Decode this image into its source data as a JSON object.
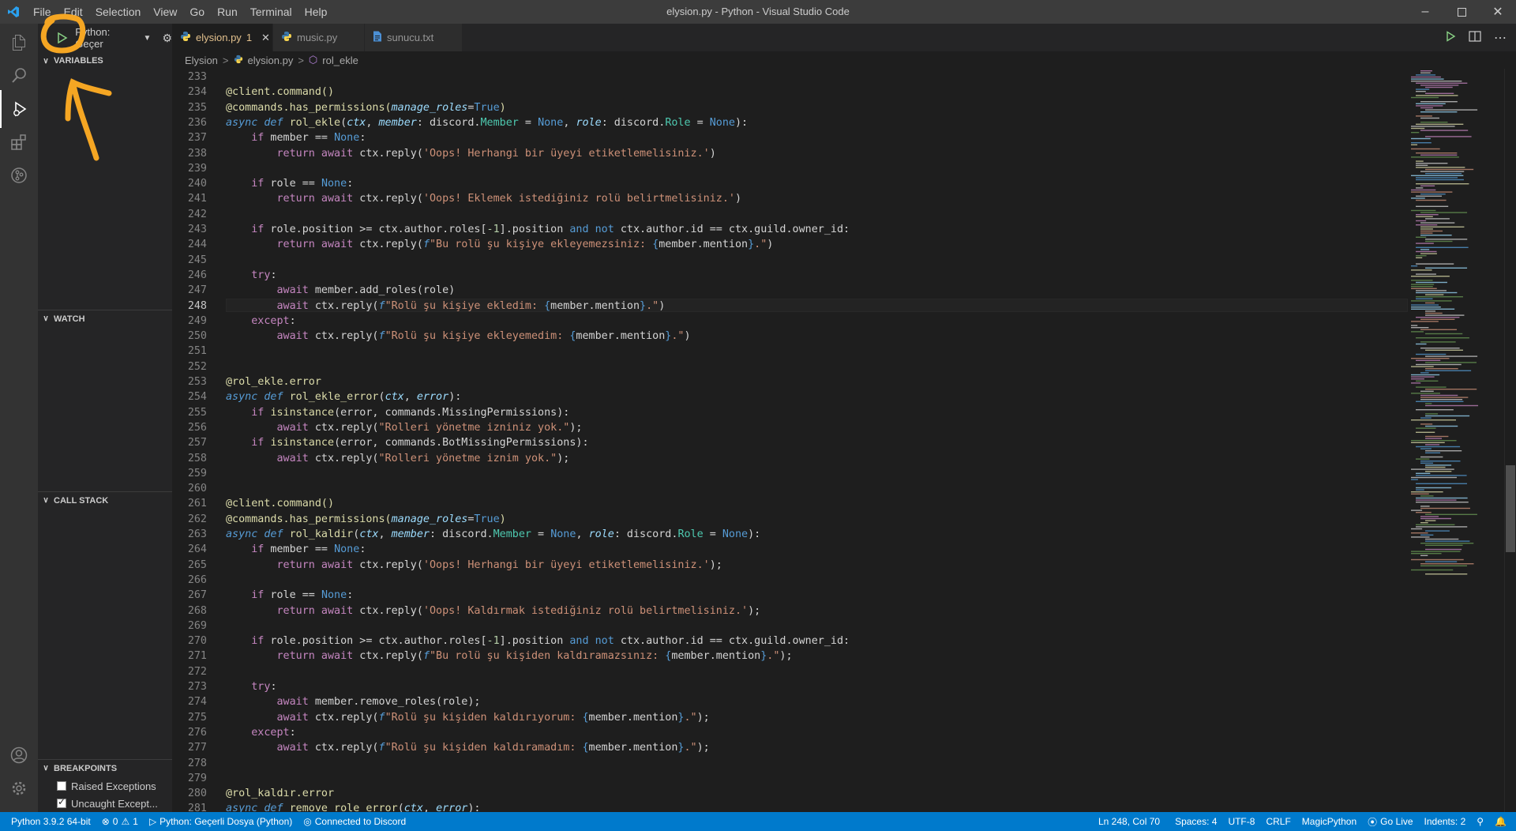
{
  "window": {
    "title": "elysion.py - Python - Visual Studio Code"
  },
  "menu": [
    "File",
    "Edit",
    "Selection",
    "View",
    "Go",
    "Run",
    "Terminal",
    "Help"
  ],
  "debug": {
    "config": "Python: Geçer"
  },
  "sidebar": {
    "sections": {
      "variables": "VARIABLES",
      "watch": "WATCH",
      "call_stack": "CALL STACK",
      "breakpoints": "BREAKPOINTS"
    },
    "breakpoints": [
      {
        "label": "Raised Exceptions",
        "checked": false
      },
      {
        "label": "Uncaught Except...",
        "checked": true
      }
    ]
  },
  "tabs": [
    {
      "label": "elysion.py",
      "modified": "1",
      "active": true,
      "icon": "python-icon"
    },
    {
      "label": "music.py",
      "active": false,
      "icon": "python-icon"
    },
    {
      "label": "sunucu.txt",
      "active": false,
      "icon": "text-file-icon"
    }
  ],
  "breadcrumbs": {
    "folder": "Elysion",
    "file": "elysion.py",
    "symbol": "rol_ekle"
  },
  "editor": {
    "current_line": 248,
    "lines": [
      {
        "n": "233",
        "t": []
      },
      {
        "n": "234",
        "t": [
          [
            "dec",
            "@client.command()"
          ]
        ]
      },
      {
        "n": "235",
        "t": [
          [
            "dec",
            "@commands.has_permissions("
          ],
          [
            "pm",
            "manage_roles"
          ],
          [
            "pl",
            "="
          ],
          [
            "cst",
            "True"
          ],
          [
            "dec",
            ")"
          ]
        ]
      },
      {
        "n": "236",
        "t": [
          [
            "sk",
            "async def "
          ],
          [
            "fn",
            "rol_ekle"
          ],
          [
            "pl",
            "("
          ],
          [
            "pm",
            "ctx"
          ],
          [
            "pl",
            ", "
          ],
          [
            "pm",
            "member"
          ],
          [
            "pl",
            ": discord."
          ],
          [
            "cls",
            "Member"
          ],
          [
            "pl",
            " = "
          ],
          [
            "cst",
            "None"
          ],
          [
            "pl",
            ", "
          ],
          [
            "pm",
            "role"
          ],
          [
            "pl",
            ": discord."
          ],
          [
            "cls",
            "Role"
          ],
          [
            "pl",
            " = "
          ],
          [
            "cst",
            "None"
          ],
          [
            "pl",
            "):"
          ]
        ]
      },
      {
        "n": "237",
        "t": [
          [
            "pl",
            "    "
          ],
          [
            "kw",
            "if"
          ],
          [
            "pl",
            " member == "
          ],
          [
            "cst",
            "None"
          ],
          [
            "pl",
            ":"
          ]
        ]
      },
      {
        "n": "238",
        "t": [
          [
            "pl",
            "        "
          ],
          [
            "kw",
            "return await"
          ],
          [
            "pl",
            " ctx.reply("
          ],
          [
            "str",
            "'Oops! Herhangi bir üyeyi etiketlemelisiniz.'"
          ],
          [
            "pl",
            ")"
          ]
        ]
      },
      {
        "n": "239",
        "t": []
      },
      {
        "n": "240",
        "t": [
          [
            "pl",
            "    "
          ],
          [
            "kw",
            "if"
          ],
          [
            "pl",
            " role == "
          ],
          [
            "cst",
            "None"
          ],
          [
            "pl",
            ":"
          ]
        ]
      },
      {
        "n": "241",
        "t": [
          [
            "pl",
            "        "
          ],
          [
            "kw",
            "return await"
          ],
          [
            "pl",
            " ctx.reply("
          ],
          [
            "str",
            "'Oops! Eklemek istediğiniz rolü belirtmelisiniz.'"
          ],
          [
            "pl",
            ")"
          ]
        ]
      },
      {
        "n": "242",
        "t": []
      },
      {
        "n": "243",
        "t": [
          [
            "pl",
            "    "
          ],
          [
            "kw",
            "if"
          ],
          [
            "pl",
            " role.position >= ctx.author.roles["
          ],
          [
            "num",
            "-1"
          ],
          [
            "pl",
            "].position "
          ],
          [
            "cst",
            "and not"
          ],
          [
            "pl",
            " ctx.author.id == ctx.guild.owner_id:"
          ]
        ]
      },
      {
        "n": "244",
        "t": [
          [
            "pl",
            "        "
          ],
          [
            "kw",
            "return await"
          ],
          [
            "pl",
            " ctx.reply("
          ],
          [
            "fpre",
            "f"
          ],
          [
            "str",
            "\"Bu rolü şu kişiye ekleyemezsiniz: "
          ],
          [
            "br",
            "{"
          ],
          [
            "pl",
            "member.mention"
          ],
          [
            "br",
            "}"
          ],
          [
            "str",
            ".\""
          ],
          [
            "pl",
            ")"
          ]
        ]
      },
      {
        "n": "245",
        "t": []
      },
      {
        "n": "246",
        "t": [
          [
            "pl",
            "    "
          ],
          [
            "kw",
            "try"
          ],
          [
            "pl",
            ":"
          ]
        ]
      },
      {
        "n": "247",
        "t": [
          [
            "pl",
            "        "
          ],
          [
            "kw",
            "await"
          ],
          [
            "pl",
            " member.add_roles(role)"
          ]
        ]
      },
      {
        "n": "248",
        "t": [
          [
            "pl",
            "        "
          ],
          [
            "kw",
            "await"
          ],
          [
            "pl",
            " ctx.reply("
          ],
          [
            "fpre",
            "f"
          ],
          [
            "str",
            "\"Rolü şu kişiye ekledim: "
          ],
          [
            "br",
            "{"
          ],
          [
            "pl",
            "member.mention"
          ],
          [
            "br",
            "}"
          ],
          [
            "str",
            ".\""
          ],
          [
            "pl",
            ")"
          ]
        ]
      },
      {
        "n": "249",
        "t": [
          [
            "pl",
            "    "
          ],
          [
            "kw",
            "except"
          ],
          [
            "pl",
            ":"
          ]
        ]
      },
      {
        "n": "250",
        "t": [
          [
            "pl",
            "        "
          ],
          [
            "kw",
            "await"
          ],
          [
            "pl",
            " ctx.reply("
          ],
          [
            "fpre",
            "f"
          ],
          [
            "str",
            "\"Rolü şu kişiye ekleyemedim: "
          ],
          [
            "br",
            "{"
          ],
          [
            "pl",
            "member.mention"
          ],
          [
            "br",
            "}"
          ],
          [
            "str",
            ".\""
          ],
          [
            "pl",
            ")"
          ]
        ]
      },
      {
        "n": "251",
        "t": []
      },
      {
        "n": "252",
        "t": []
      },
      {
        "n": "253",
        "t": [
          [
            "dec",
            "@rol_ekle.error"
          ]
        ]
      },
      {
        "n": "254",
        "t": [
          [
            "sk",
            "async def "
          ],
          [
            "fn",
            "rol_ekle_error"
          ],
          [
            "pl",
            "("
          ],
          [
            "pm",
            "ctx"
          ],
          [
            "pl",
            ", "
          ],
          [
            "pm",
            "error"
          ],
          [
            "pl",
            "):"
          ]
        ]
      },
      {
        "n": "255",
        "t": [
          [
            "pl",
            "    "
          ],
          [
            "kw",
            "if"
          ],
          [
            "pl",
            " "
          ],
          [
            "fn",
            "isinstance"
          ],
          [
            "pl",
            "(error, commands.MissingPermissions):"
          ]
        ]
      },
      {
        "n": "256",
        "t": [
          [
            "pl",
            "        "
          ],
          [
            "kw",
            "await"
          ],
          [
            "pl",
            " ctx.reply("
          ],
          [
            "str",
            "\"Rolleri yönetme izniniz yok.\""
          ],
          [
            "pl",
            ");"
          ]
        ]
      },
      {
        "n": "257",
        "t": [
          [
            "pl",
            "    "
          ],
          [
            "kw",
            "if"
          ],
          [
            "pl",
            " "
          ],
          [
            "fn",
            "isinstance"
          ],
          [
            "pl",
            "(error, commands.BotMissingPermissions):"
          ]
        ]
      },
      {
        "n": "258",
        "t": [
          [
            "pl",
            "        "
          ],
          [
            "kw",
            "await"
          ],
          [
            "pl",
            " ctx.reply("
          ],
          [
            "str",
            "\"Rolleri yönetme iznim yok.\""
          ],
          [
            "pl",
            ");"
          ]
        ]
      },
      {
        "n": "259",
        "t": []
      },
      {
        "n": "260",
        "t": []
      },
      {
        "n": "261",
        "t": [
          [
            "dec",
            "@client.command()"
          ]
        ]
      },
      {
        "n": "262",
        "t": [
          [
            "dec",
            "@commands.has_permissions("
          ],
          [
            "pm",
            "manage_roles"
          ],
          [
            "pl",
            "="
          ],
          [
            "cst",
            "True"
          ],
          [
            "dec",
            ")"
          ]
        ]
      },
      {
        "n": "263",
        "t": [
          [
            "sk",
            "async def "
          ],
          [
            "fn",
            "rol_kaldir"
          ],
          [
            "pl",
            "("
          ],
          [
            "pm",
            "ctx"
          ],
          [
            "pl",
            ", "
          ],
          [
            "pm",
            "member"
          ],
          [
            "pl",
            ": discord."
          ],
          [
            "cls",
            "Member"
          ],
          [
            "pl",
            " = "
          ],
          [
            "cst",
            "None"
          ],
          [
            "pl",
            ", "
          ],
          [
            "pm",
            "role"
          ],
          [
            "pl",
            ": discord."
          ],
          [
            "cls",
            "Role"
          ],
          [
            "pl",
            " = "
          ],
          [
            "cst",
            "None"
          ],
          [
            "pl",
            "):"
          ]
        ]
      },
      {
        "n": "264",
        "t": [
          [
            "pl",
            "    "
          ],
          [
            "kw",
            "if"
          ],
          [
            "pl",
            " member == "
          ],
          [
            "cst",
            "None"
          ],
          [
            "pl",
            ":"
          ]
        ]
      },
      {
        "n": "265",
        "t": [
          [
            "pl",
            "        "
          ],
          [
            "kw",
            "return await"
          ],
          [
            "pl",
            " ctx.reply("
          ],
          [
            "str",
            "'Oops! Herhangi bir üyeyi etiketlemelisiniz.'"
          ],
          [
            "pl",
            ");"
          ]
        ]
      },
      {
        "n": "266",
        "t": []
      },
      {
        "n": "267",
        "t": [
          [
            "pl",
            "    "
          ],
          [
            "kw",
            "if"
          ],
          [
            "pl",
            " role == "
          ],
          [
            "cst",
            "None"
          ],
          [
            "pl",
            ":"
          ]
        ]
      },
      {
        "n": "268",
        "t": [
          [
            "pl",
            "        "
          ],
          [
            "kw",
            "return await"
          ],
          [
            "pl",
            " ctx.reply("
          ],
          [
            "str",
            "'Oops! Kaldırmak istediğiniz rolü belirtmelisiniz.'"
          ],
          [
            "pl",
            ");"
          ]
        ]
      },
      {
        "n": "269",
        "t": []
      },
      {
        "n": "270",
        "t": [
          [
            "pl",
            "    "
          ],
          [
            "kw",
            "if"
          ],
          [
            "pl",
            " role.position >= ctx.author.roles["
          ],
          [
            "num",
            "-1"
          ],
          [
            "pl",
            "].position "
          ],
          [
            "cst",
            "and not"
          ],
          [
            "pl",
            " ctx.author.id == ctx.guild.owner_id:"
          ]
        ]
      },
      {
        "n": "271",
        "t": [
          [
            "pl",
            "        "
          ],
          [
            "kw",
            "return await"
          ],
          [
            "pl",
            " ctx.reply("
          ],
          [
            "fpre",
            "f"
          ],
          [
            "str",
            "\"Bu rolü şu kişiden kaldıramazsınız: "
          ],
          [
            "br",
            "{"
          ],
          [
            "pl",
            "member.mention"
          ],
          [
            "br",
            "}"
          ],
          [
            "str",
            ".\""
          ],
          [
            "pl",
            ");"
          ]
        ]
      },
      {
        "n": "272",
        "t": []
      },
      {
        "n": "273",
        "t": [
          [
            "pl",
            "    "
          ],
          [
            "kw",
            "try"
          ],
          [
            "pl",
            ":"
          ]
        ]
      },
      {
        "n": "274",
        "t": [
          [
            "pl",
            "        "
          ],
          [
            "kw",
            "await"
          ],
          [
            "pl",
            " member.remove_roles(role);"
          ]
        ]
      },
      {
        "n": "275",
        "t": [
          [
            "pl",
            "        "
          ],
          [
            "kw",
            "await"
          ],
          [
            "pl",
            " ctx.reply("
          ],
          [
            "fpre",
            "f"
          ],
          [
            "str",
            "\"Rolü şu kişiden kaldırıyorum: "
          ],
          [
            "br",
            "{"
          ],
          [
            "pl",
            "member.mention"
          ],
          [
            "br",
            "}"
          ],
          [
            "str",
            ".\""
          ],
          [
            "pl",
            ");"
          ]
        ]
      },
      {
        "n": "276",
        "t": [
          [
            "pl",
            "    "
          ],
          [
            "kw",
            "except"
          ],
          [
            "pl",
            ":"
          ]
        ]
      },
      {
        "n": "277",
        "t": [
          [
            "pl",
            "        "
          ],
          [
            "kw",
            "await"
          ],
          [
            "pl",
            " ctx.reply("
          ],
          [
            "fpre",
            "f"
          ],
          [
            "str",
            "\"Rolü şu kişiden kaldıramadım: "
          ],
          [
            "br",
            "{"
          ],
          [
            "pl",
            "member.mention"
          ],
          [
            "br",
            "}"
          ],
          [
            "str",
            ".\""
          ],
          [
            "pl",
            ");"
          ]
        ]
      },
      {
        "n": "278",
        "t": []
      },
      {
        "n": "279",
        "t": []
      },
      {
        "n": "280",
        "t": [
          [
            "dec",
            "@rol_kaldır.error"
          ]
        ]
      },
      {
        "n": "281",
        "t": [
          [
            "sk",
            "async def "
          ],
          [
            "fn",
            "remove_role_error"
          ],
          [
            "pl",
            "("
          ],
          [
            "pm",
            "ctx"
          ],
          [
            "pl",
            ", "
          ],
          [
            "pm",
            "error"
          ],
          [
            "pl",
            "):"
          ]
        ]
      }
    ]
  },
  "status": {
    "interpreter": "Python 3.9.2 64-bit",
    "errors": "0",
    "warnings": "1",
    "debug_config": "Python: Geçerli Dosya (Python)",
    "discord": "Connected to Discord",
    "position": "Ln 248, Col 70",
    "spaces": "Spaces: 4",
    "encoding": "UTF-8",
    "eol": "CRLF",
    "language": "MagicPython",
    "golive": "Go Live",
    "indents": "Indents: 2"
  },
  "colors": {
    "statusbar": "#007acc",
    "annotation": "#f5a623",
    "editor_bg": "#1e1e1e"
  }
}
